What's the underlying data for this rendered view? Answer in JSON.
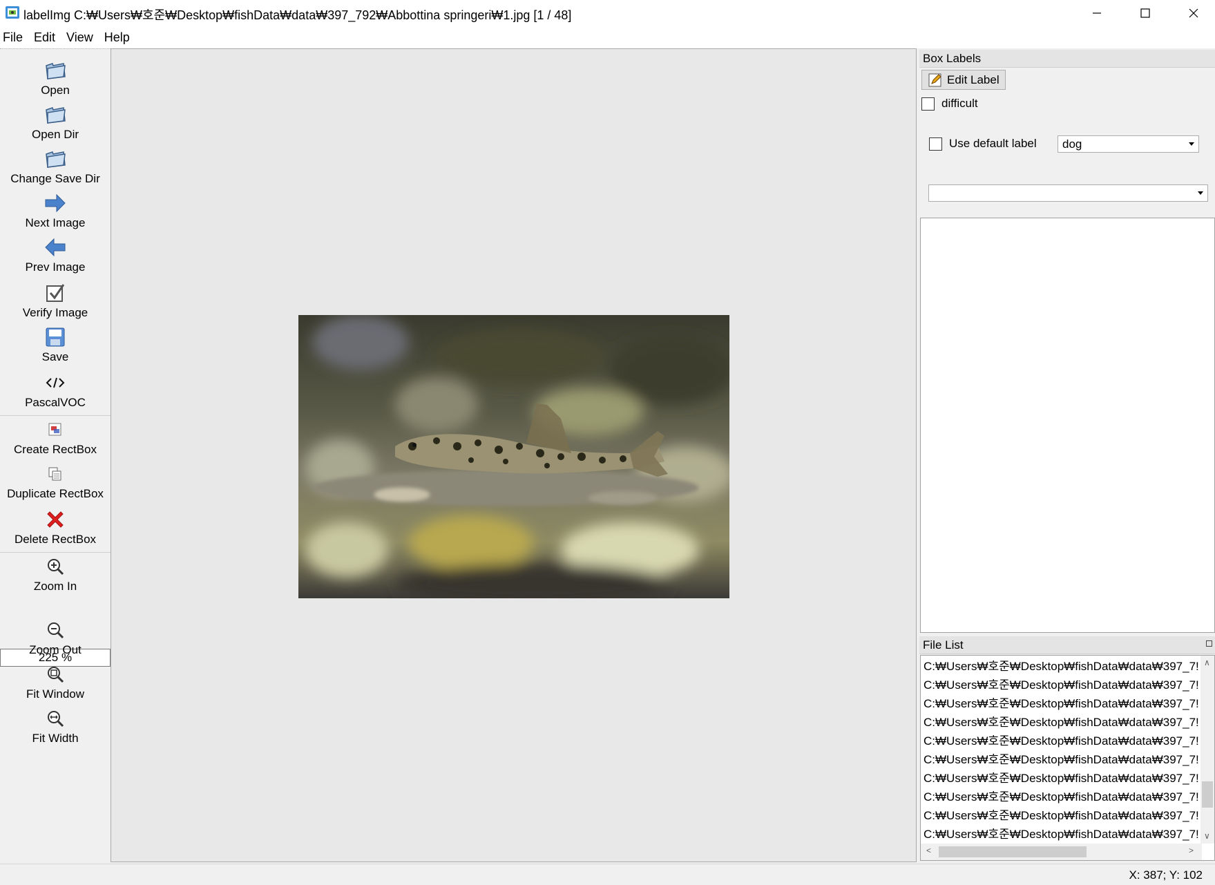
{
  "window": {
    "title": "labelImg C:₩Users₩호준₩Desktop₩fishData₩data₩397_792₩Abbottina springeri₩1.jpg [1 / 48]"
  },
  "menu": [
    "File",
    "Edit",
    "View",
    "Help"
  ],
  "toolbar": {
    "open": "Open",
    "open_dir": "Open Dir",
    "change_save_dir": "Change Save Dir",
    "next_image": "Next Image",
    "prev_image": "Prev Image",
    "verify_image": "Verify Image",
    "save": "Save",
    "format": "PascalVOC",
    "create_rectbox": "Create RectBox",
    "duplicate_rectbox": "Duplicate RectBox",
    "delete_rectbox": "Delete RectBox",
    "zoom_in": "Zoom In",
    "zoom_level": "225 %",
    "zoom_out": "Zoom Out",
    "fit_window": "Fit Window",
    "fit_width": "Fit Width"
  },
  "box_labels": {
    "title": "Box Labels",
    "edit_label": "Edit Label",
    "difficult": "difficult",
    "use_default_label": "Use default label",
    "default_label_value": "dog",
    "second_combo_value": ""
  },
  "file_list": {
    "title": "File List",
    "items": [
      "C:₩Users₩호준₩Desktop₩fishData₩data₩397_7!",
      "C:₩Users₩호준₩Desktop₩fishData₩data₩397_7!",
      "C:₩Users₩호준₩Desktop₩fishData₩data₩397_7!",
      "C:₩Users₩호준₩Desktop₩fishData₩data₩397_7!",
      "C:₩Users₩호준₩Desktop₩fishData₩data₩397_7!",
      "C:₩Users₩호준₩Desktop₩fishData₩data₩397_7!",
      "C:₩Users₩호준₩Desktop₩fishData₩data₩397_7!",
      "C:₩Users₩호준₩Desktop₩fishData₩data₩397_7!",
      "C:₩Users₩호준₩Desktop₩fishData₩data₩397_7!",
      "C:₩Users₩호준₩Desktop₩fishData₩data₩397_7!"
    ]
  },
  "status": {
    "coords": "X: 387; Y: 102"
  },
  "colors": {
    "accent_blue": "#3d78c8",
    "delete_red": "#e02020"
  }
}
